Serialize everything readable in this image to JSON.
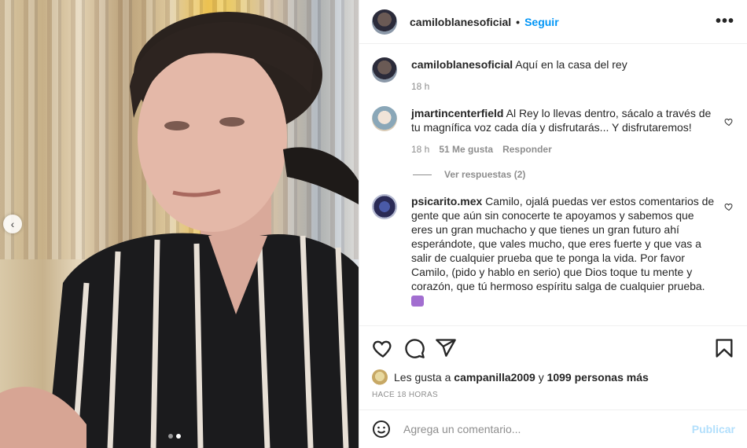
{
  "post": {
    "username": "camiloblanesoficial",
    "follow_label": "Seguir",
    "separator": "•",
    "more_icon": "more-horizontal-icon",
    "caption_username": "camiloblanesoficial",
    "caption_text": "Aquí en la casa del rey",
    "caption_time": "18 h"
  },
  "comments": [
    {
      "username": "jmartincenterfield",
      "text": "Al Rey lo llevas dentro, sácalo a través de tu magnífica voz cada día y disfrutarás... Y disfrutaremos!",
      "time": "18 h",
      "likes": "51 Me gusta",
      "reply": "Responder",
      "view_replies": "Ver respuestas (2)"
    },
    {
      "username": "psicarito.mex",
      "text": "Camilo, ojalá puedas ver estos comentarios de gente que aún sin conocerte te apoyamos y sabemos que eres un gran muchacho y que tienes un gran futuro ahí esperándote, que vales mucho, que eres fuerte y que vas a salir de cualquier prueba que te ponga la vida. Por favor Camilo, (pido y hablo en serio) que Dios toque tu mente y corazón, que tú hermoso espíritu salga de cualquier prueba."
    }
  ],
  "likes": {
    "prefix": "Les gusta a",
    "user": "campanilla2009",
    "joiner": "y",
    "others": "1099 personas más"
  },
  "timestamp": "HACE 18 HORAS",
  "comment_box": {
    "placeholder": "Agrega un comentario...",
    "publish": "Publicar"
  },
  "colors": {
    "accent": "#0095f6",
    "publish_disabled": "#b2dffc",
    "muted": "#8e8e8e"
  },
  "carousel": {
    "prev_arrow": "‹",
    "slide_count": 2,
    "active_slide": 2
  }
}
